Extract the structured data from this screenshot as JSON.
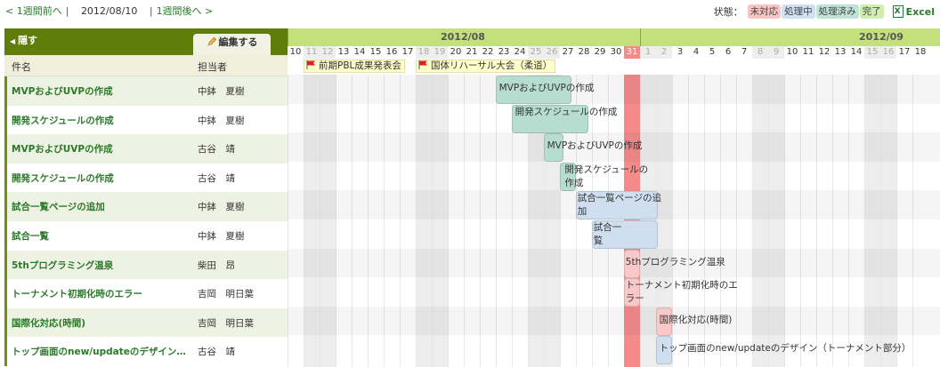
{
  "nav": {
    "prev": "< 1週間前へ",
    "date": "2012/08/10",
    "next": "1週間後へ >"
  },
  "status": {
    "label": "状態：",
    "items": [
      "未対応",
      "処理中",
      "処理済み",
      "完了"
    ],
    "excel": "Excel"
  },
  "left": {
    "hide_label": "隠す",
    "edit_label": "編集する",
    "col_name": "件名",
    "col_assignee": "担当者"
  },
  "months": [
    "2012/08",
    "2012/09"
  ],
  "days": [
    "10",
    "11",
    "12",
    "13",
    "14",
    "15",
    "16",
    "17",
    "18",
    "19",
    "20",
    "21",
    "22",
    "23",
    "24",
    "25",
    "26",
    "27",
    "28",
    "29",
    "30",
    "31",
    "1",
    "2",
    "3",
    "4",
    "5",
    "6",
    "7",
    "8",
    "9",
    "10",
    "11",
    "12",
    "13",
    "14",
    "15",
    "16",
    "17",
    "18"
  ],
  "events": [
    {
      "label": "前期PBL成果発表会"
    },
    {
      "label": "国体リハーサル大会（柔道）"
    }
  ],
  "rows": [
    {
      "name": "MVPおよびUVPの作成",
      "assignee": "中鉢　夏樹",
      "bar_label": "MVPおよびUVPの作成"
    },
    {
      "name": "開発スケジュールの作成",
      "assignee": "中鉢　夏樹",
      "bar_label": "開発スケジュールの作成"
    },
    {
      "name": "MVPおよびUVPの作成",
      "assignee": "古谷　靖",
      "bar_label": "MVPおよびUVPの作成"
    },
    {
      "name": "開発スケジュールの作成",
      "assignee": "古谷　靖",
      "bar_label": "開発スケジュールの作成"
    },
    {
      "name": "試合一覧ページの追加",
      "assignee": "中鉢　夏樹",
      "bar_label": "試合一覧ページの追加"
    },
    {
      "name": "試合一覧",
      "assignee": "中鉢　夏樹",
      "bar_label": "試合一覧"
    },
    {
      "name": "5thプログラミング温泉",
      "assignee": "柴田　昂",
      "bar_label": "5thプログラミング温泉"
    },
    {
      "name": "トーナメント初期化時のエラー",
      "assignee": "吉岡　明日葉",
      "bar_label": "トーナメント初期化時のエラー"
    },
    {
      "name": "国際化対応(時間)",
      "assignee": "吉岡　明日葉",
      "bar_label": "国際化対応(時間)"
    },
    {
      "name": "トップ画面のnew/updateのデザイン…",
      "assignee": "古谷　靖",
      "bar_label": "トップ画面のnew/updateのデザイン（トーナメント部分）"
    }
  ]
}
